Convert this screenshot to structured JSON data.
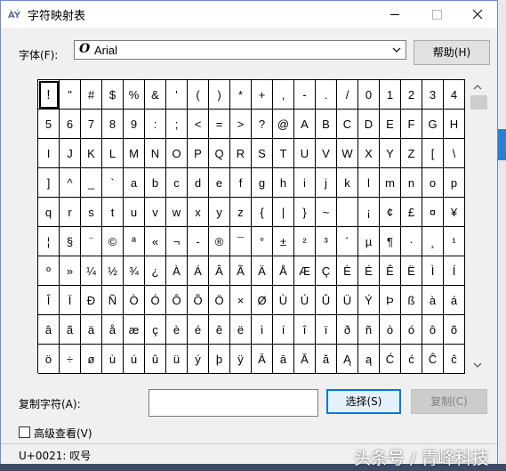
{
  "window": {
    "title": "字符映射表"
  },
  "font_row": {
    "label": "字体(F):",
    "selected_font": "Arial",
    "help_button": "帮助(H)"
  },
  "characters": [
    "!",
    "\"",
    "#",
    "$",
    "%",
    "&",
    "'",
    "(",
    ")",
    "*",
    "+",
    ",",
    "-",
    ".",
    "/",
    "0",
    "1",
    "2",
    "3",
    "4",
    "5",
    "6",
    "7",
    "8",
    "9",
    ":",
    ";",
    "<",
    "=",
    ">",
    "?",
    "@",
    "A",
    "B",
    "C",
    "D",
    "E",
    "F",
    "G",
    "H",
    "I",
    "J",
    "K",
    "L",
    "M",
    "N",
    "O",
    "P",
    "Q",
    "R",
    "S",
    "T",
    "U",
    "V",
    "W",
    "X",
    "Y",
    "Z",
    "[",
    "\\",
    "]",
    "^",
    "_",
    "`",
    "a",
    "b",
    "c",
    "d",
    "e",
    "f",
    "g",
    "h",
    "i",
    "j",
    "k",
    "l",
    "m",
    "n",
    "o",
    "p",
    "q",
    "r",
    "s",
    "t",
    "u",
    "v",
    "w",
    "x",
    "y",
    "z",
    "{",
    "|",
    "}",
    "~",
    " ",
    "¡",
    "¢",
    "£",
    "¤",
    "¥",
    "¦",
    "§",
    "¨",
    "©",
    "ª",
    "«",
    "¬",
    "-",
    "®",
    "¯",
    "°",
    "±",
    "²",
    "³",
    "´",
    "µ",
    "¶",
    "·",
    "¸",
    "¹",
    "º",
    "»",
    "¼",
    "½",
    "¾",
    "¿",
    "À",
    "Á",
    "Â",
    "Ã",
    "Ä",
    "Å",
    "Æ",
    "Ç",
    "È",
    "É",
    "Ê",
    "Ë",
    "Ì",
    "Í",
    "Î",
    "Ï",
    "Ð",
    "Ñ",
    "Ò",
    "Ó",
    "Ô",
    "Õ",
    "Ö",
    "×",
    "Ø",
    "Ù",
    "Ú",
    "Û",
    "Ü",
    "Ý",
    "Þ",
    "ß",
    "à",
    "á",
    "â",
    "ã",
    "ä",
    "å",
    "æ",
    "ç",
    "è",
    "é",
    "ê",
    "ë",
    "ì",
    "í",
    "î",
    "ï",
    "ð",
    "ñ",
    "ò",
    "ó",
    "ô",
    "õ",
    "ö",
    "÷",
    "ø",
    "ù",
    "ú",
    "û",
    "ü",
    "ý",
    "þ",
    "ÿ",
    "Ā",
    "ā",
    "Ă",
    "ă",
    "Ą",
    "ą",
    "Ć",
    "ć",
    "Ĉ",
    "ĉ"
  ],
  "selected_char_index": 0,
  "copy_row": {
    "label": "复制字符(A):",
    "value": "",
    "select_button": "选择(S)",
    "copy_button": "复制(C)"
  },
  "advanced_view": {
    "label": "高级查看(V)",
    "checked": false
  },
  "status": {
    "text": "U+0021: 叹号"
  },
  "watermark": {
    "text": "头条号 / 青峰科技"
  },
  "colors": {
    "focus_border": "#0078d7",
    "window_border": "#6b8ccf"
  }
}
